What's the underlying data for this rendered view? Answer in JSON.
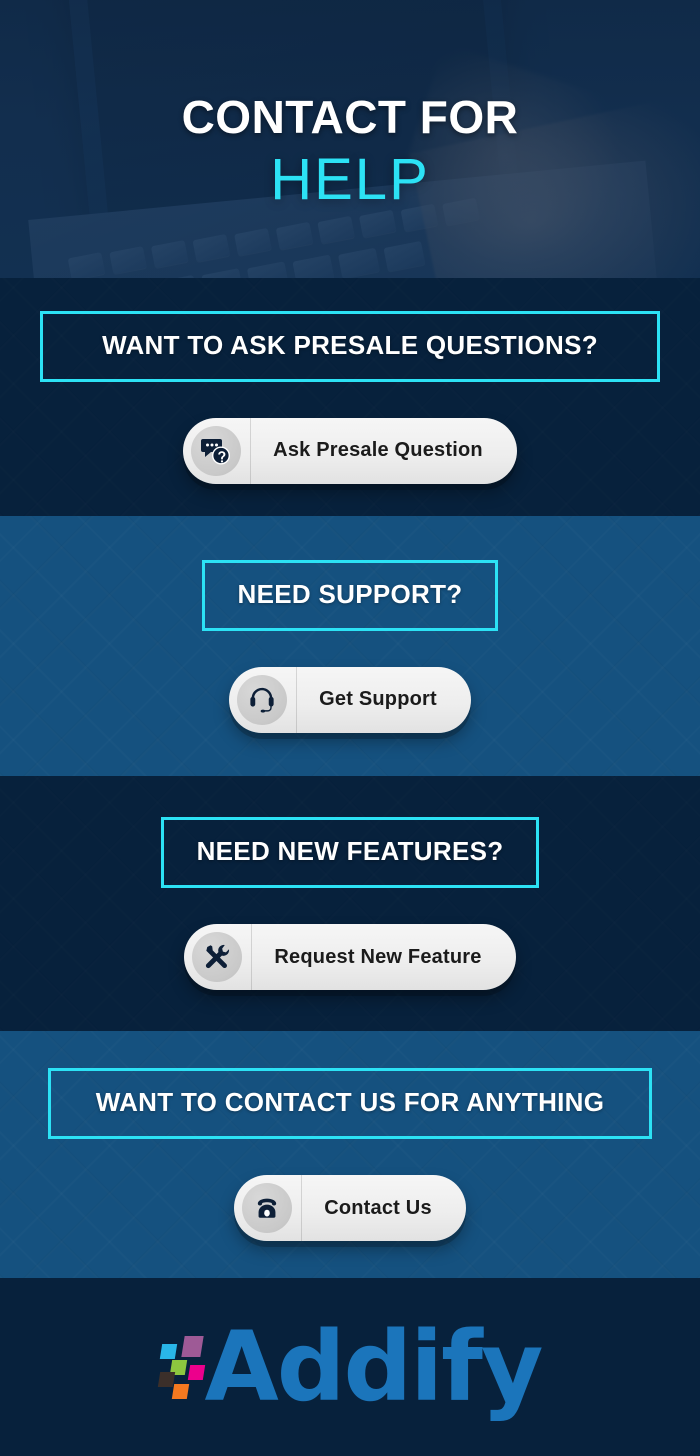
{
  "hero": {
    "title_line1": "CONTACT FOR",
    "title_line2": "HELP",
    "background_image": "laptop-typing-photo"
  },
  "colors": {
    "accent_cyan": "#2ce2f5",
    "dark_navy": "#07213c",
    "mid_blue": "#15517f",
    "logo_blue": "#1b75bb",
    "button_face": "#ededed",
    "button_text": "#1b1b1b"
  },
  "sections": [
    {
      "heading": "WANT TO ASK PRESALE QUESTIONS?",
      "button_label": "Ask Presale Question",
      "icon": "speech-bubbles-question-icon",
      "background": "dark"
    },
    {
      "heading": "NEED SUPPORT?",
      "button_label": "Get Support",
      "icon": "headset-icon",
      "background": "blue"
    },
    {
      "heading": "NEED NEW FEATURES?",
      "button_label": "Request New Feature",
      "icon": "wrench-screwdriver-icon",
      "background": "dark"
    },
    {
      "heading": "WANT TO CONTACT US FOR ANYTHING",
      "button_label": "Contact Us",
      "icon": "rotary-telephone-icon",
      "background": "blue"
    }
  ],
  "footer": {
    "brand": "Addify",
    "logo_mark_colors": [
      "#29b6e8",
      "#a05a96",
      "#8dc63f",
      "#ec008c",
      "#3b2f2a",
      "#f47920",
      "#00a7e1"
    ]
  }
}
